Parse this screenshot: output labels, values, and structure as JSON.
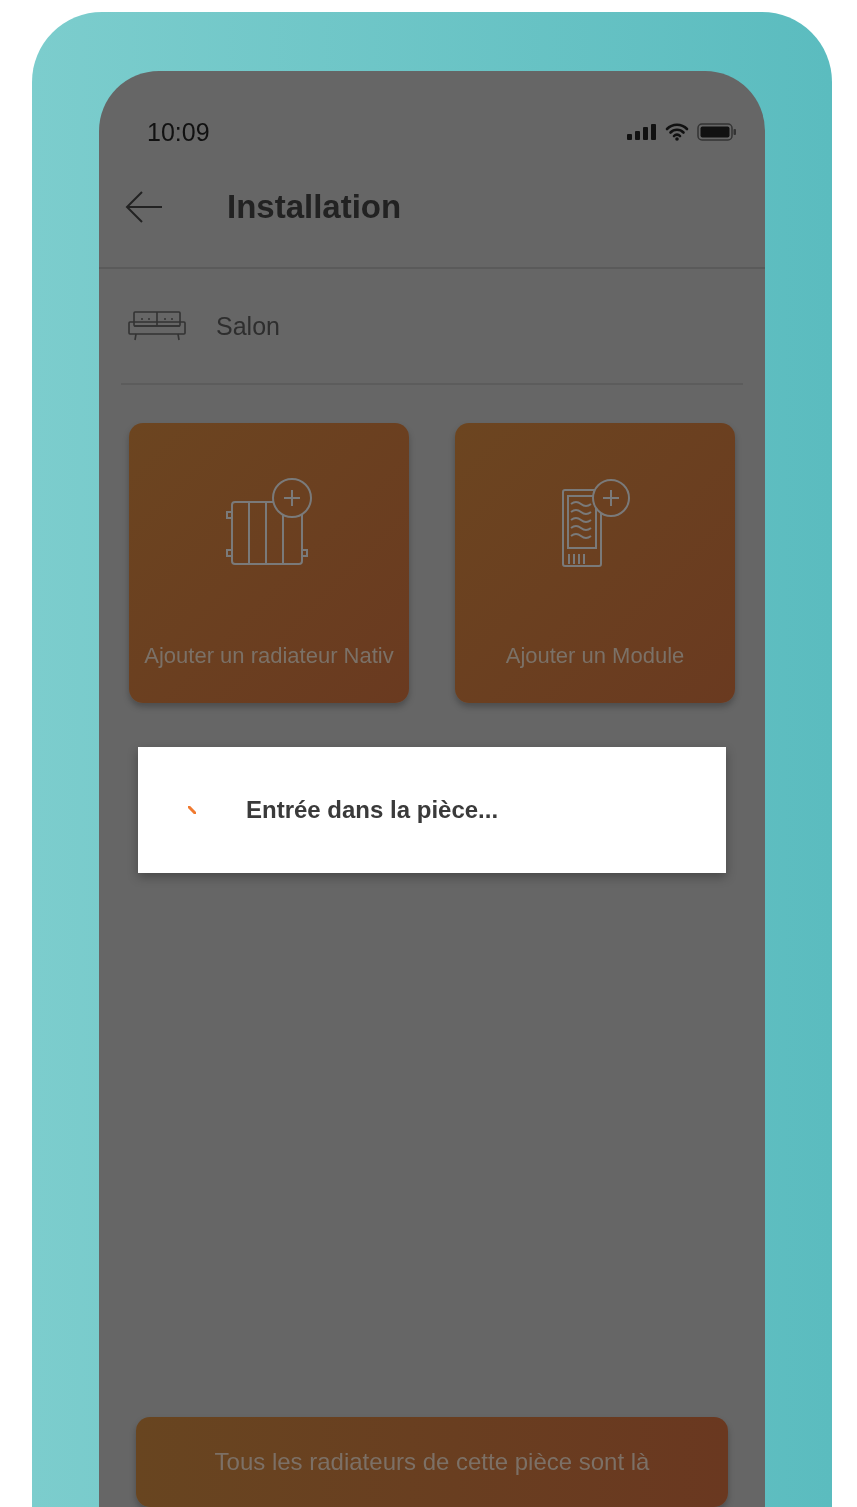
{
  "status_bar": {
    "time": "10:09"
  },
  "header": {
    "title": "Installation"
  },
  "room": {
    "name": "Salon"
  },
  "actions": [
    {
      "kind": "radiator",
      "label": "Ajouter un radiateur Nativ"
    },
    {
      "kind": "module",
      "label": "Ajouter un Module"
    }
  ],
  "dialog": {
    "message": "Entrée dans la pièce..."
  },
  "confirm_button": {
    "label": "Tous les radiateurs de cette pièce sont là"
  }
}
